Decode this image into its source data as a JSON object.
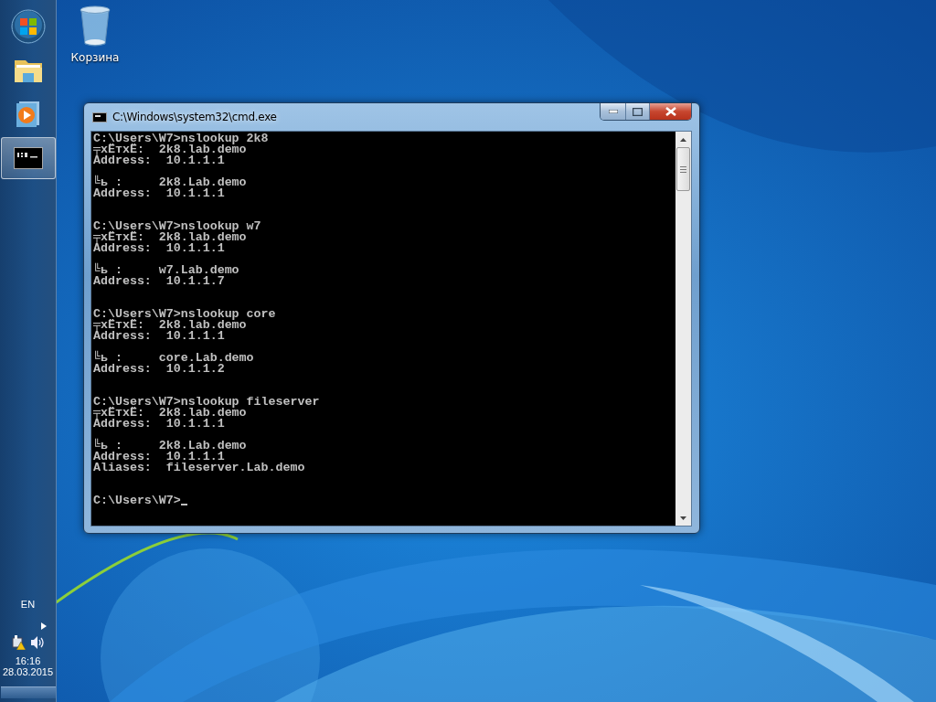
{
  "desktop": {
    "icons": [
      {
        "label": "Корзина"
      }
    ]
  },
  "taskbar": {
    "items": [
      {
        "kind": "start",
        "selected": false
      },
      {
        "kind": "explorer",
        "selected": false
      },
      {
        "kind": "media",
        "selected": false
      },
      {
        "kind": "console",
        "selected": true
      }
    ],
    "language": "EN",
    "time": "16:16",
    "date": "28.03.2015"
  },
  "window": {
    "title": "C:\\Windows\\system32\\cmd.exe",
    "lines": [
      {
        "kind": "text",
        "text": "C:\\Users\\W7>nslookup 2k8"
      },
      {
        "kind": "text",
        "text": "╤xЁтxЁ:  2k8.lab.demo"
      },
      {
        "kind": "text",
        "text": "Address:  10.1.1.1"
      },
      {
        "kind": "blank"
      },
      {
        "kind": "text",
        "text": "╚ь :     2k8.Lab.demo"
      },
      {
        "kind": "text",
        "text": "Address:  10.1.1.1"
      },
      {
        "kind": "blank"
      },
      {
        "kind": "blank"
      },
      {
        "kind": "text",
        "text": "C:\\Users\\W7>nslookup w7"
      },
      {
        "kind": "text",
        "text": "╤xЁтxЁ:  2k8.lab.demo"
      },
      {
        "kind": "text",
        "text": "Address:  10.1.1.1"
      },
      {
        "kind": "blank"
      },
      {
        "kind": "text",
        "text": "╚ь :     w7.Lab.demo"
      },
      {
        "kind": "text",
        "text": "Address:  10.1.1.7"
      },
      {
        "kind": "blank"
      },
      {
        "kind": "blank"
      },
      {
        "kind": "text",
        "text": "C:\\Users\\W7>nslookup core"
      },
      {
        "kind": "text",
        "text": "╤xЁтxЁ:  2k8.lab.demo"
      },
      {
        "kind": "text",
        "text": "Address:  10.1.1.1"
      },
      {
        "kind": "blank"
      },
      {
        "kind": "text",
        "text": "╚ь :     core.Lab.demo"
      },
      {
        "kind": "text",
        "text": "Address:  10.1.1.2"
      },
      {
        "kind": "blank"
      },
      {
        "kind": "blank"
      },
      {
        "kind": "text",
        "text": "C:\\Users\\W7>nslookup fileserver"
      },
      {
        "kind": "text",
        "text": "╤xЁтxЁ:  2k8.lab.demo"
      },
      {
        "kind": "text",
        "text": "Address:  10.1.1.1"
      },
      {
        "kind": "blank"
      },
      {
        "kind": "text",
        "text": "╚ь :     2k8.Lab.demo"
      },
      {
        "kind": "text",
        "text": "Address:  10.1.1.1"
      },
      {
        "kind": "text",
        "text": "Aliases:  fileserver.Lab.demo"
      },
      {
        "kind": "blank"
      },
      {
        "kind": "blank"
      },
      {
        "kind": "prompt",
        "text": "C:\\Users\\W7>"
      }
    ]
  }
}
